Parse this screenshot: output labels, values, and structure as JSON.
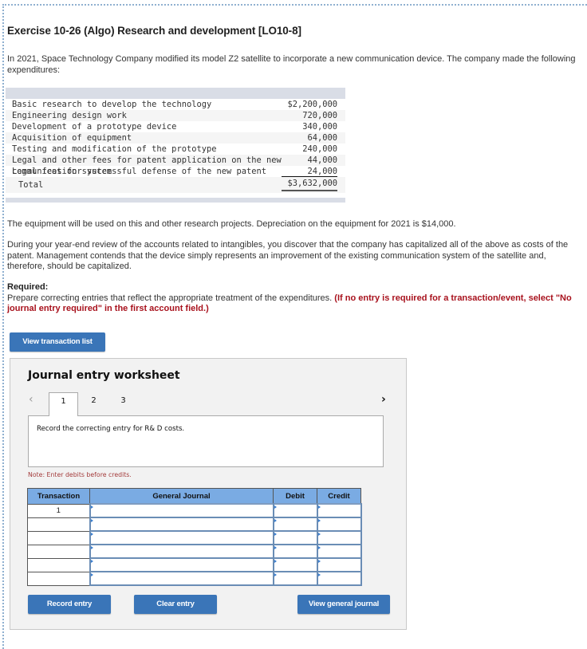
{
  "exercise": {
    "title": "Exercise 10-26 (Algo) Research and development [LO10-8]",
    "intro": "In 2021, Space Technology Company modified its model Z2 satellite to incorporate a new communication device. The company made the following expenditures:",
    "expenditures": [
      {
        "label": "Basic research to develop the technology",
        "amount": "$2,200,000"
      },
      {
        "label": "Engineering design work",
        "amount": "720,000"
      },
      {
        "label": "Development of a prototype device",
        "amount": "340,000"
      },
      {
        "label": "Acquisition of equipment",
        "amount": "64,000"
      },
      {
        "label": "Testing and modification of the prototype",
        "amount": "240,000"
      },
      {
        "label": "Legal and other fees for patent application on the new communication system",
        "amount": "44,000"
      },
      {
        "label": "Legal fees for successful defense of the new patent",
        "amount": "24,000"
      }
    ],
    "total_label": "Total",
    "total_amount": "$3,632,000",
    "equipment_note": "The equipment will be used on this and other research projects. Depreciation on the equipment for 2021 is $14,000.",
    "review_note": "During your year-end review of the accounts related to intangibles, you discover that the company has capitalized all of the above as costs of the patent. Management contends that the device simply represents an improvement of the existing communication system of the satellite and, therefore, should be capitalized.",
    "required_label": "Required:",
    "required_text": "Prepare correcting entries that reflect the appropriate treatment of the expenditures. ",
    "required_note": "(If no entry is required for a transaction/event, select \"No journal entry required\" in the first account field.)"
  },
  "buttons": {
    "view_transaction_list": "View transaction list",
    "record_entry": "Record entry",
    "clear_entry": "Clear entry",
    "view_general_journal": "View general journal"
  },
  "worksheet": {
    "title": "Journal entry worksheet",
    "tabs": [
      "1",
      "2",
      "3"
    ],
    "active_tab": "1",
    "prev_icon": "‹",
    "next_icon": "›",
    "description": "Record the correcting entry for R& D costs.",
    "note": "Note: Enter debits before credits.",
    "columns": [
      "Transaction",
      "General Journal",
      "Debit",
      "Credit"
    ],
    "rows": [
      {
        "transaction": "1",
        "account": "",
        "debit": "",
        "credit": ""
      },
      {
        "transaction": "",
        "account": "",
        "debit": "",
        "credit": ""
      },
      {
        "transaction": "",
        "account": "",
        "debit": "",
        "credit": ""
      },
      {
        "transaction": "",
        "account": "",
        "debit": "",
        "credit": ""
      },
      {
        "transaction": "",
        "account": "",
        "debit": "",
        "credit": ""
      },
      {
        "transaction": "",
        "account": "",
        "debit": "",
        "credit": ""
      }
    ]
  },
  "colors": {
    "button_blue": "#3a75b8",
    "header_blue": "#7aabe3",
    "note_red": "#a8121d"
  }
}
